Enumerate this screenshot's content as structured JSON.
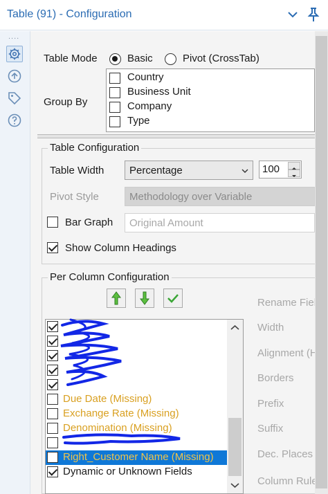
{
  "header": {
    "title": "Table (91) - Configuration"
  },
  "rail": {
    "dots": "....",
    "icons": [
      "gear-icon",
      "connect-icon",
      "tag-icon",
      "help-icon"
    ]
  },
  "table_mode": {
    "label": "Table Mode",
    "options": [
      "Basic",
      "Pivot (CrossTab)"
    ],
    "selected": "Basic"
  },
  "group_by": {
    "label": "Group By",
    "items": [
      {
        "label": "Country",
        "checked": false
      },
      {
        "label": "Business Unit",
        "checked": false
      },
      {
        "label": "Company",
        "checked": false
      },
      {
        "label": "Type",
        "checked": false
      }
    ]
  },
  "table_config": {
    "legend": "Table Configuration",
    "table_width_label": "Table Width",
    "table_width_value": "Percentage",
    "width_amount": "100",
    "pivot_style_label": "Pivot Style",
    "pivot_style_value": "Methodology over Variable",
    "bar_graph_label": "Bar Graph",
    "bar_graph_checked": false,
    "bar_graph_field": "Original Amount",
    "show_headings_label": "Show Column Headings",
    "show_headings_checked": true
  },
  "per_column": {
    "legend": "Per Column Configuration",
    "buttons": [
      "move-up-button",
      "move-down-button",
      "check-all-button"
    ],
    "columns": [
      {
        "label": "",
        "checked": true,
        "state": "redacted"
      },
      {
        "label": "",
        "checked": true,
        "state": "redacted"
      },
      {
        "label": "",
        "checked": true,
        "state": "redacted"
      },
      {
        "label": "",
        "checked": true,
        "state": "redacted"
      },
      {
        "label": "",
        "checked": true,
        "state": "redacted"
      },
      {
        "label": "Due Date (Missing)",
        "checked": false,
        "state": "missing"
      },
      {
        "label": "Exchange Rate (Missing)",
        "checked": false,
        "state": "missing"
      },
      {
        "label": "Denomination (Missing)",
        "checked": false,
        "state": "missing"
      },
      {
        "label": "",
        "checked": false,
        "state": "redacted-missing"
      },
      {
        "label": "Right_Customer Name (Missing)",
        "checked": false,
        "state": "selected-missing"
      },
      {
        "label": "Dynamic or Unknown Fields",
        "checked": true,
        "state": "normal"
      }
    ],
    "property_labels": [
      "Rename Fiel",
      "Width",
      "Alignment (H",
      "Borders",
      "Prefix",
      "Suffix",
      "Dec. Places",
      "Column Rule"
    ]
  },
  "colors": {
    "title_blue": "#2b6cb3",
    "missing_text": "#d9a021",
    "selection": "#0f78d7",
    "redaction_ink": "#1227e6",
    "arrow_green": "#3aa635"
  }
}
